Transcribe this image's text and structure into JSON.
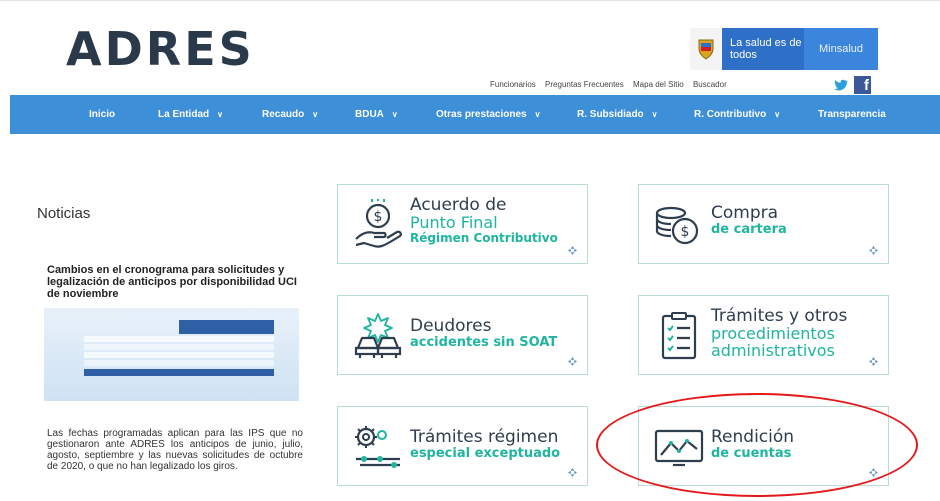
{
  "header": {
    "logo_text": "ADRES",
    "gov_salud": "La salud es de todos",
    "gov_min": "Minsalud",
    "utility_links": [
      "Funcionarios",
      "Preguntas Frecuentes",
      "Mapa del Sitio",
      "Buscador"
    ]
  },
  "nav": {
    "items": [
      {
        "label": "Inicio",
        "dropdown": false
      },
      {
        "label": "La Entidad",
        "dropdown": true
      },
      {
        "label": "Recaudo",
        "dropdown": true
      },
      {
        "label": "BDUA",
        "dropdown": true
      },
      {
        "label": "Otras prestaciones",
        "dropdown": true
      },
      {
        "label": "R. Subsidiado",
        "dropdown": true
      },
      {
        "label": "R. Contributivo",
        "dropdown": true
      },
      {
        "label": "Transparencia",
        "dropdown": false
      }
    ]
  },
  "news": {
    "heading": "Noticias",
    "title": "Cambios en el cronograma para solicitudes y legalización de anticipos por disponibilidad UCI de noviembre",
    "body": "Las fechas programadas aplican para las IPS que no gestionaron ante ADRES los anticipos de junio, julio, agosto, septiembre y las nuevas solicitudes de octubre de 2020, o que no han legalizado los giros."
  },
  "cards": [
    {
      "id": "acuerdo",
      "line1": "Acuerdo de",
      "line2": "Punto Final",
      "line3": "Régimen Contributivo",
      "icon": "hand-coin-icon"
    },
    {
      "id": "compra",
      "line1": "Compra",
      "line2": "de cartera",
      "icon": "coins-icon"
    },
    {
      "id": "deudores",
      "line1": "Deudores",
      "line2": "accidentes sin SOAT",
      "icon": "car-crash-icon"
    },
    {
      "id": "tramites-otros",
      "line1": "Trámites y otros",
      "line2": "procedimientos",
      "line3": "administrativos",
      "icon": "clipboard-icon"
    },
    {
      "id": "tramites-regimen",
      "line1": "Trámites régimen",
      "line2": "especial exceptuado",
      "icon": "gears-icon"
    },
    {
      "id": "rendicion",
      "line1": "Rendición",
      "line2": "de cuentas",
      "icon": "monitor-chart-icon"
    }
  ],
  "colors": {
    "nav_bg": "#3d8fd8",
    "accent_green": "#1fb59f",
    "highlight_red": "#e51919",
    "logo_dark": "#2b3a4a"
  }
}
